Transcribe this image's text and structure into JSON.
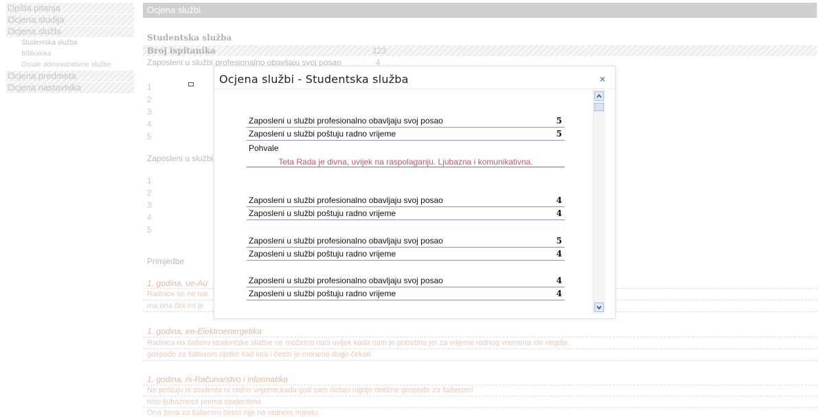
{
  "sidebar": {
    "items": [
      {
        "label": "Opšta pitanja"
      },
      {
        "label": "Ocjena studija"
      },
      {
        "label": "Ocjena službi"
      },
      {
        "label": "Ocjena predmeta"
      },
      {
        "label": "Ocjena nastavnika"
      }
    ],
    "subitems": [
      {
        "label": "Studentska služba"
      },
      {
        "label": "Biblioteka"
      },
      {
        "label": "Ostale administrativne službe"
      }
    ]
  },
  "main": {
    "header": "Ocjena službi",
    "service_name": "Studentska služba",
    "respondents_label": "Broj ispitanika",
    "respondents_value": "123",
    "question1_cut": "Zaposleni u službi profesionalno obavljaju svoj posao",
    "question1_value": "4",
    "question2_cut": "Zaposleni u službi",
    "scale": [
      "1",
      "2",
      "3",
      "4",
      "5"
    ],
    "remarks_label": "Primjedbe",
    "groups": [
      {
        "heading": "1. godina, ue-Au",
        "lines": [
          "Radnice se ne nal",
          "ma ona čini mi je"
        ]
      },
      {
        "heading": "1. godina, ee-Elektroenergetika",
        "lines": [
          "Radnica na šalteru studentske službe ne možemo naći uvijek kada nam je potrebna jer za vrijeme radnog vremena ide negdje.",
          "gospođe za šalterom rijetko kad ima i često je moramo dugo čekati"
        ]
      },
      {
        "heading": "1. godina, rii-Računarstvo i informatika",
        "lines": [
          "Ne poštuju ni studente ni radno vrijeme,kada god sam došao nigdje dotične gospođe za šalterom!",
          "nisu ljubaznosti prema studentima",
          "Ona žena za šalterom često nije na radnom mjestu."
        ]
      }
    ]
  },
  "modal": {
    "title": "Ocjena službi - Studentska služba",
    "close_label": "×",
    "blocks": [
      {
        "rows": [
          {
            "question": "Zaposleni u službi profesionalno obavljaju svoj posao",
            "value": "5"
          },
          {
            "question": "Zaposleni u službi poštuju radno vrijeme",
            "value": "5"
          }
        ],
        "praise_label": "Pohvale",
        "praise_text": "Teta Rada je divna, uvijek na raspolaganju. Ljubazna i komunikativna."
      },
      {
        "rows": [
          {
            "question": "Zaposleni u službi profesionalno obavljaju svoj posao",
            "value": "4"
          },
          {
            "question": "Zaposleni u službi poštuju radno vrijeme",
            "value": "4"
          }
        ]
      },
      {
        "rows": [
          {
            "question": "Zaposleni u službi profesionalno obavljaju svoj posao",
            "value": "5"
          },
          {
            "question": "Zaposleni u službi poštuju radno vrijeme",
            "value": "4"
          }
        ]
      },
      {
        "rows": [
          {
            "question": "Zaposleni u službi profesionalno obavljaju svoj posao",
            "value": "4"
          },
          {
            "question": "Zaposleni u službi poštuju radno vrijeme",
            "value": "4"
          }
        ]
      }
    ]
  }
}
